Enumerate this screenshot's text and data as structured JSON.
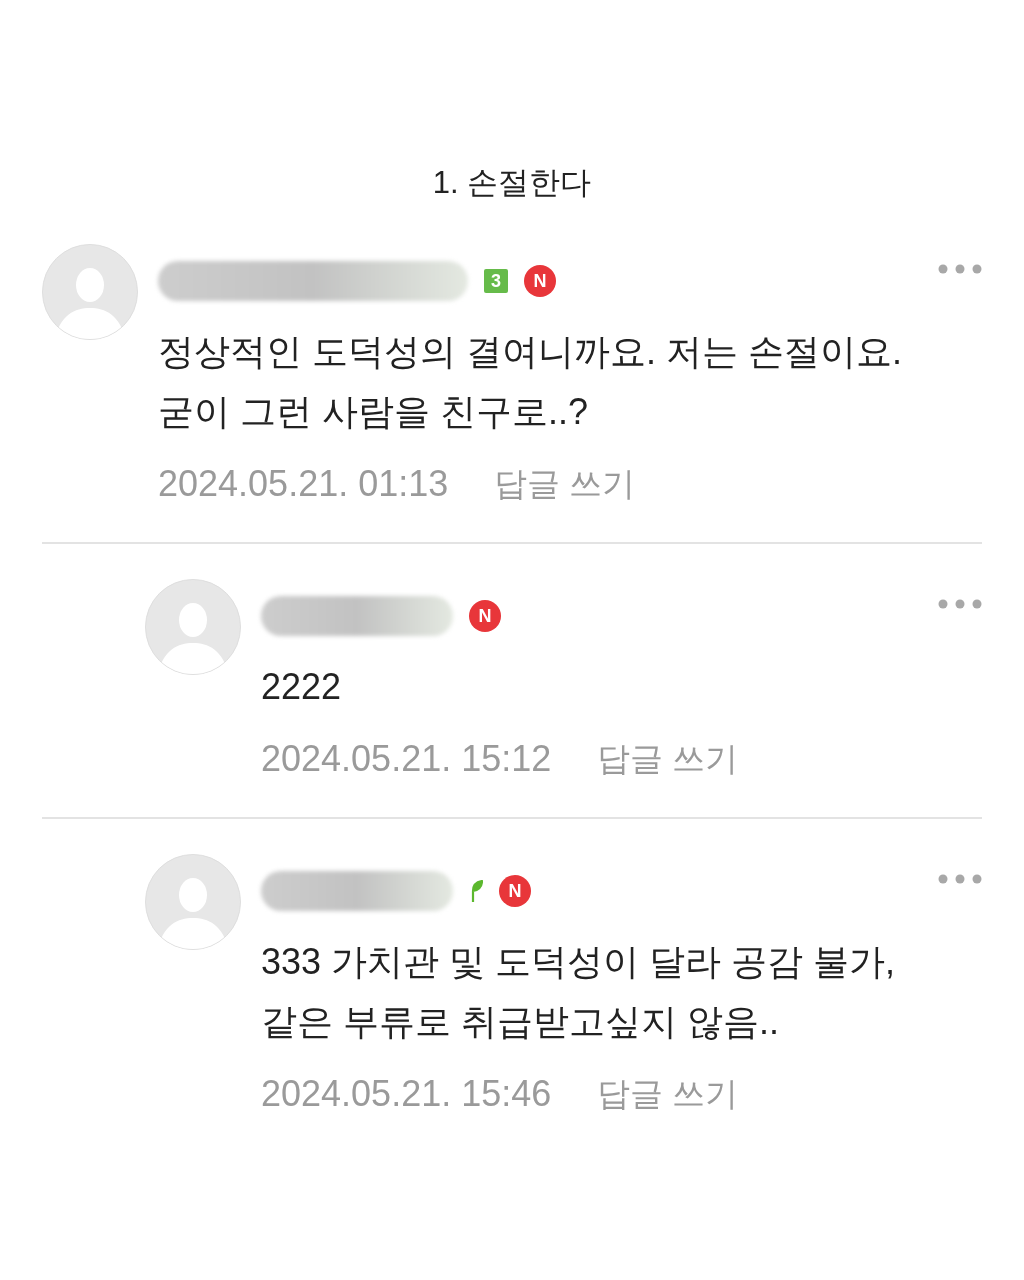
{
  "title": "1. 손절한다",
  "comments": [
    {
      "name_blurred": true,
      "badges": [
        {
          "kind": "level",
          "text": "3"
        },
        {
          "kind": "new",
          "text": "N"
        }
      ],
      "body": "정상적인 도덕성의 결여니까요. 저는 손절이요.\n굳이 그런 사람을 친구로..?",
      "date": "2024.05.21. 01:13",
      "reply_link": "답글 쓰기",
      "children": [
        {
          "name_blurred": true,
          "badges": [
            {
              "kind": "new",
              "text": "N"
            }
          ],
          "body": "2222",
          "date": "2024.05.21. 15:12",
          "reply_link": "답글 쓰기"
        },
        {
          "name_blurred": true,
          "badges": [
            {
              "kind": "sprout"
            },
            {
              "kind": "new",
              "text": "N"
            }
          ],
          "body": "333 가치관 및 도덕성이 달라 공감 불가,\n같은 부류로 취급받고싶지 않음..",
          "date": "2024.05.21. 15:46",
          "reply_link": "답글 쓰기"
        }
      ]
    }
  ]
}
